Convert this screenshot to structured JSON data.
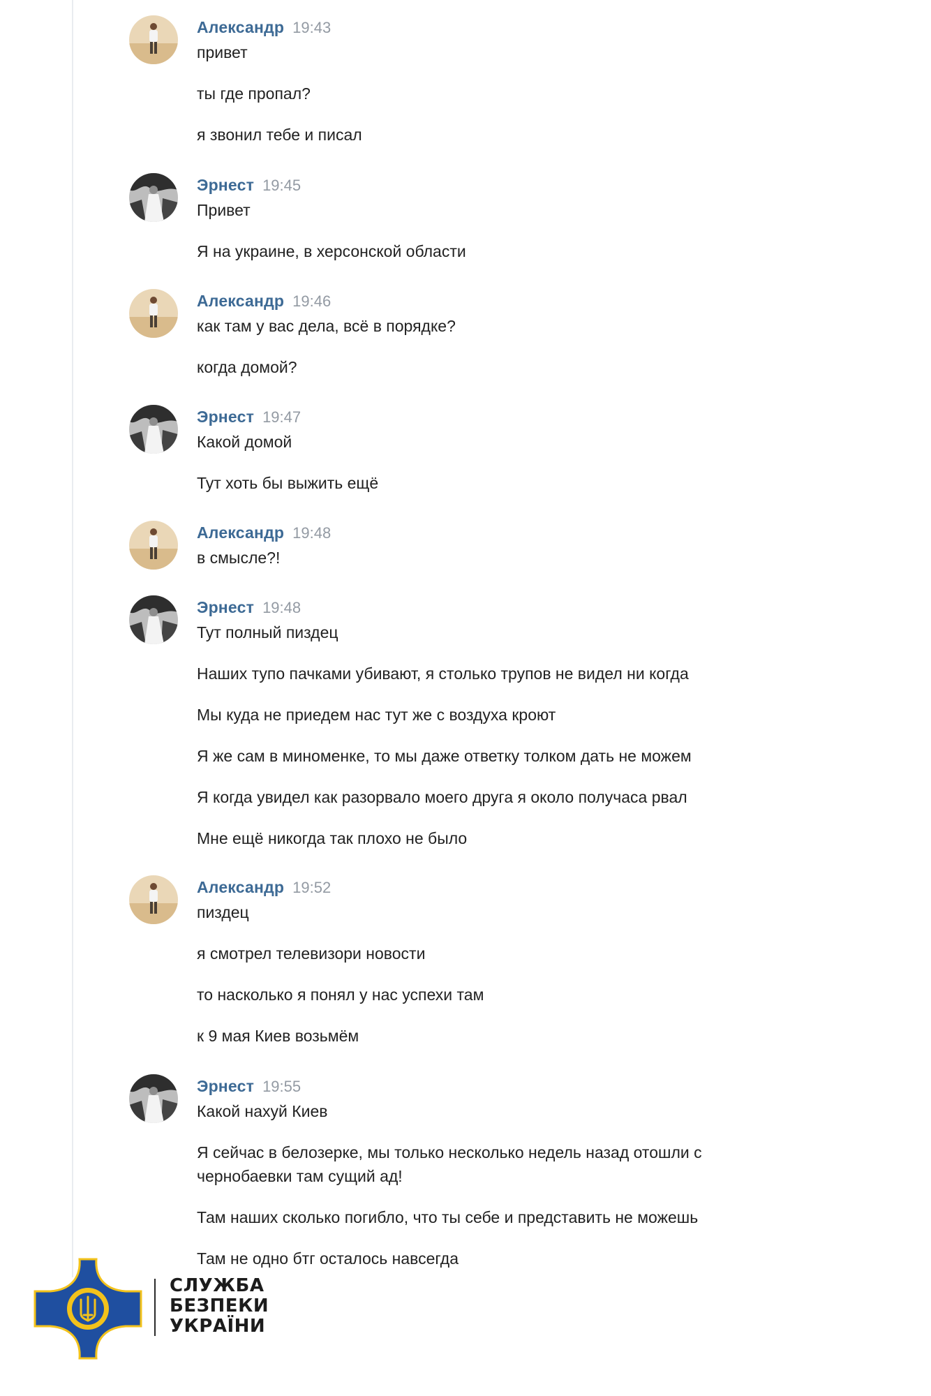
{
  "messages": [
    {
      "author": "Александр",
      "time": "19:43",
      "lines": [
        "привет",
        "ты где пропал?",
        "я звонил тебе и писал"
      ]
    },
    {
      "author": "Эрнест",
      "time": "19:45",
      "lines": [
        "Привет",
        "Я на украине, в херсонской области"
      ]
    },
    {
      "author": "Александр",
      "time": "19:46",
      "lines": [
        "как там у вас дела, всё в порядке?",
        "когда домой?"
      ]
    },
    {
      "author": "Эрнест",
      "time": "19:47",
      "lines": [
        "Какой домой",
        "Тут хоть бы выжить ещё"
      ]
    },
    {
      "author": "Александр",
      "time": "19:48",
      "lines": [
        "в смысле?!"
      ]
    },
    {
      "author": "Эрнест",
      "time": "19:48",
      "lines": [
        "Тут полный пиздец",
        "Наших тупо пачками убивают, я столько трупов не видел ни когда",
        "Мы куда не приедем нас тут же с воздуха кроют",
        "Я же сам в миноменке, то мы даже ответку толком дать не можем",
        "Я когда увидел как разорвало моего друга я около получаса рвал",
        "Мне ещё никогда так плохо не было"
      ]
    },
    {
      "author": "Александр",
      "time": "19:52",
      "lines": [
        "пиздец",
        "я смотрел телевизори новости",
        "то насколько я понял у нас успехи там",
        "к 9 мая Киев возьмём"
      ]
    },
    {
      "author": "Эрнест",
      "time": "19:55",
      "lines": [
        "Какой нахуй Киев",
        "Я сейчас в белозерке, мы только несколько недель назад отошли с чернобаевки там сущий ад!",
        "Там наших сколько погибло, что ты себе и представить не можешь",
        "Там не одно бтг осталось навсегда"
      ]
    }
  ],
  "watermark": {
    "lines": [
      "СЛУЖБА",
      "БЕЗПЕКИ",
      "УКРАЇНИ"
    ],
    "colors": {
      "cross": "#1f4fa0",
      "emblem": "#f2c21b"
    }
  }
}
